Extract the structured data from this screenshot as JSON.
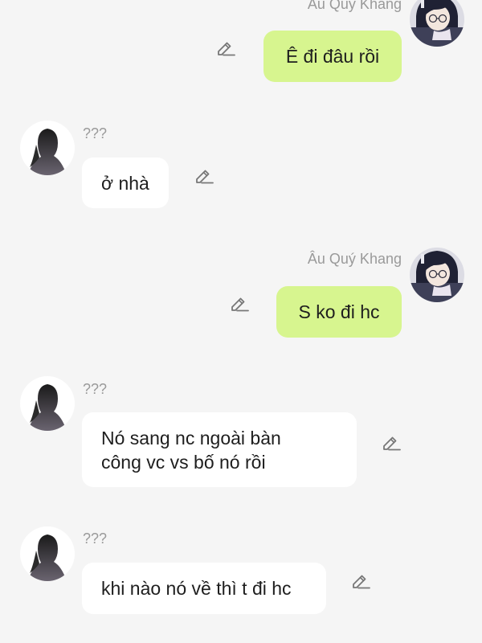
{
  "messages": [
    {
      "direction": "outgoing",
      "sender": "Âu Quý Khang",
      "text": "Ê đi đâu rồi"
    },
    {
      "direction": "incoming",
      "sender": "???",
      "text": "ở nhà"
    },
    {
      "direction": "outgoing",
      "sender": "Âu Quý Khang",
      "text": "S ko đi hc"
    },
    {
      "direction": "incoming",
      "sender": "???",
      "text_lines": [
        "Nó sang nc ngoài bàn",
        "công vc vs bố nó rồi"
      ]
    },
    {
      "direction": "incoming",
      "sender": "???",
      "text": "khi nào nó về thì t đi hc"
    }
  ],
  "colors": {
    "background": "#f5f5f5",
    "outgoing_bubble": "#d7f58f",
    "incoming_bubble": "#ffffff",
    "sender_name": "#9a9a9a"
  },
  "icons": {
    "edit": "pencil-edit-icon",
    "incoming_avatar": "silhouette-avatar",
    "outgoing_avatar": "anime-avatar"
  }
}
